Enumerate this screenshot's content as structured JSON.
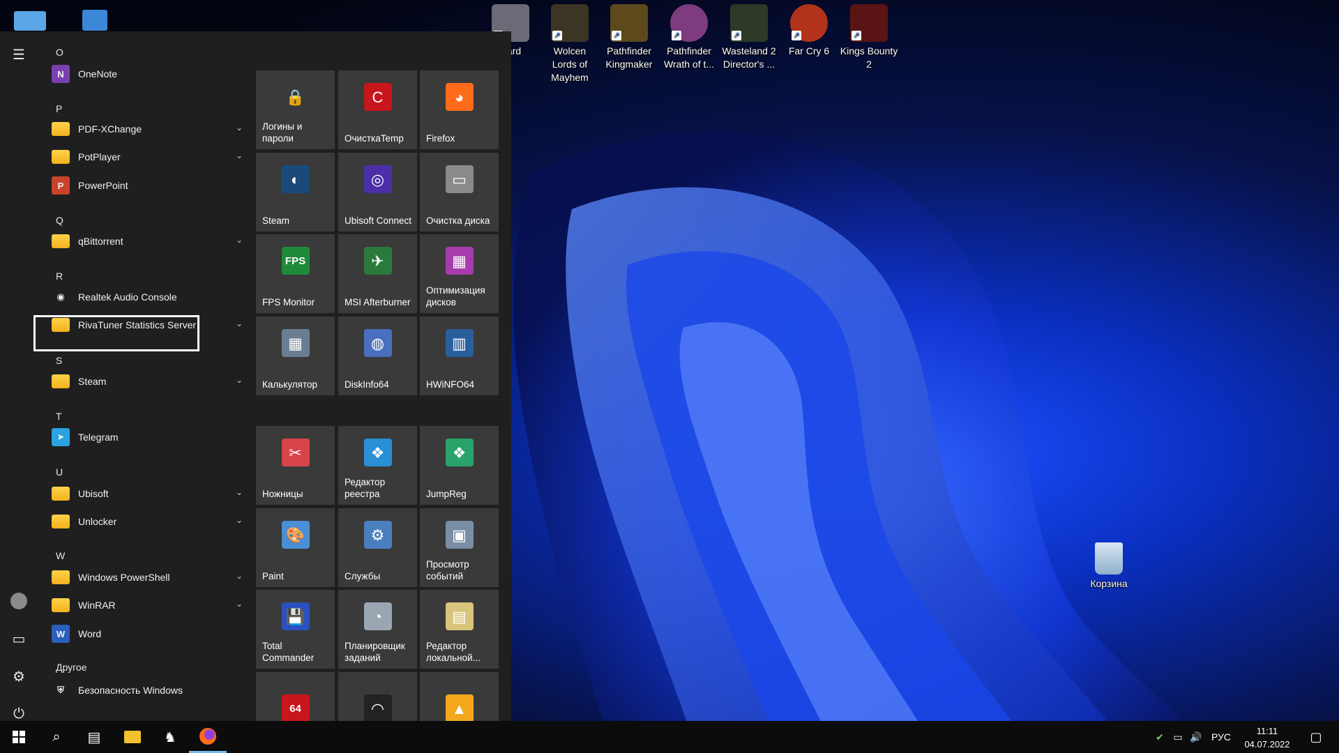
{
  "desktop": {
    "icons": [
      {
        "label": "ward",
        "color": "#6b6b78",
        "symbol": "✦"
      },
      {
        "label": "Wolcen Lords of Mayhem",
        "color": "#3d3524",
        "symbol": "W"
      },
      {
        "label": "Pathfinder Kingmaker",
        "color": "#5c4a1c",
        "symbol": "P"
      },
      {
        "label": "Pathfinder Wrath of t...",
        "color": "#7c3c7e",
        "symbol": "P"
      },
      {
        "label": "Wasteland 2 Director's ...",
        "color": "#2e3a28",
        "symbol": "▲"
      },
      {
        "label": "Far Cry 6",
        "color": "#b2321a",
        "symbol": "▲"
      },
      {
        "label": "Kings Bounty 2",
        "color": "#5a1414",
        "symbol": "♛"
      }
    ],
    "recycle_bin": {
      "label": "Корзина"
    }
  },
  "start_menu": {
    "rail": {
      "menu_icon": "hamburger-icon",
      "user_icon": "user-avatar-icon",
      "documents_icon": "documents-icon",
      "settings_icon": "gear-icon",
      "power_icon": "power-icon"
    },
    "apps": [
      {
        "type": "letter",
        "text": "O"
      },
      {
        "type": "app",
        "label": "OneNote",
        "icon": "onenote-icon",
        "color": "#7b3fb2",
        "glyph": "N",
        "expand": false
      },
      {
        "type": "letter",
        "text": "P"
      },
      {
        "type": "app",
        "label": "PDF-XChange",
        "icon": "folder-icon",
        "folder": true,
        "expand": true
      },
      {
        "type": "app",
        "label": "PotPlayer",
        "icon": "folder-icon",
        "folder": true,
        "expand": true
      },
      {
        "type": "app",
        "label": "PowerPoint",
        "icon": "powerpoint-icon",
        "color": "#c9432a",
        "glyph": "P",
        "expand": false
      },
      {
        "type": "letter",
        "text": "Q"
      },
      {
        "type": "app",
        "label": "qBittorrent",
        "icon": "folder-icon",
        "folder": true,
        "expand": true
      },
      {
        "type": "letter",
        "text": "R"
      },
      {
        "type": "app",
        "label": "Realtek Audio Console",
        "icon": "realtek-icon",
        "color": "#1f1f1f",
        "glyph": "◉",
        "expand": false
      },
      {
        "type": "app",
        "label": "RivaTuner Statistics Server",
        "icon": "folder-icon",
        "folder": true,
        "expand": true
      },
      {
        "type": "letter",
        "text": "S"
      },
      {
        "type": "app",
        "label": "Steam",
        "icon": "folder-icon",
        "folder": true,
        "expand": true
      },
      {
        "type": "letter",
        "text": "T"
      },
      {
        "type": "app",
        "label": "Telegram",
        "icon": "telegram-icon",
        "color": "#2aa3e0",
        "glyph": "➤",
        "expand": false
      },
      {
        "type": "letter",
        "text": "U"
      },
      {
        "type": "app",
        "label": "Ubisoft",
        "icon": "folder-icon",
        "folder": true,
        "expand": true
      },
      {
        "type": "app",
        "label": "Unlocker",
        "icon": "folder-icon",
        "folder": true,
        "expand": true
      },
      {
        "type": "letter",
        "text": "W"
      },
      {
        "type": "app",
        "label": "Windows PowerShell",
        "icon": "folder-icon",
        "folder": true,
        "expand": true
      },
      {
        "type": "app",
        "label": "WinRAR",
        "icon": "folder-icon",
        "folder": true,
        "expand": true
      },
      {
        "type": "app",
        "label": "Word",
        "icon": "word-icon",
        "color": "#2b5fbd",
        "glyph": "W",
        "expand": false
      },
      {
        "type": "letter",
        "text": "Другое"
      },
      {
        "type": "app",
        "label": "Безопасность Windows",
        "icon": "shield-icon",
        "color": "#1f1f1f",
        "glyph": "⛨",
        "expand": false
      }
    ],
    "tiles": [
      {
        "label": "Логины и пароли",
        "icon": "lock-icon",
        "glyph": "🔒",
        "color": "transparent"
      },
      {
        "label": "ОчисткаTemp",
        "icon": "ccleaner-icon",
        "glyph": "C",
        "color": "#c8161d"
      },
      {
        "label": "Firefox",
        "icon": "firefox-icon",
        "glyph": "◕",
        "color": "#ff6b1a"
      },
      {
        "label": "Steam",
        "icon": "steam-icon",
        "glyph": "◐",
        "color": "#1b4a7a"
      },
      {
        "label": "Ubisoft Connect",
        "icon": "ubisoft-icon",
        "glyph": "◎",
        "color": "#4a2fa8"
      },
      {
        "label": "Очистка диска",
        "icon": "disk-cleanup-icon",
        "glyph": "▭",
        "color": "#8a8a8a"
      },
      {
        "label": "FPS Monitor",
        "icon": "fps-monitor-icon",
        "glyph": "FPS",
        "color": "#1f8a3a"
      },
      {
        "label": "MSI Afterburner",
        "icon": "afterburner-icon",
        "glyph": "✈",
        "color": "#2b7a3c"
      },
      {
        "label": "Оптимизация дисков",
        "icon": "defrag-icon",
        "glyph": "▦",
        "color": "#a83cae"
      },
      {
        "label": "Калькулятор",
        "icon": "calculator-icon",
        "glyph": "▦",
        "color": "#6a7d93"
      },
      {
        "label": "DiskInfo64",
        "icon": "diskinfo-icon",
        "glyph": "◍",
        "color": "#4a6fbf"
      },
      {
        "label": "HWiNFO64",
        "icon": "hwinfo-icon",
        "glyph": "▥",
        "color": "#2a5f9e"
      },
      {
        "label": "Ножницы",
        "icon": "scissors-icon",
        "glyph": "✂",
        "color": "#d8444a"
      },
      {
        "label": "Редактор реестра",
        "icon": "registry-icon",
        "glyph": "❖",
        "color": "#2b8fd6"
      },
      {
        "label": "JumpReg",
        "icon": "jumpreg-icon",
        "glyph": "❖",
        "color": "#2aa36a"
      },
      {
        "label": "Paint",
        "icon": "paint-icon",
        "glyph": "🎨",
        "color": "#4a8fd6"
      },
      {
        "label": "Службы",
        "icon": "services-icon",
        "glyph": "⚙",
        "color": "#4a7fbf"
      },
      {
        "label": "Просмотр событий",
        "icon": "event-viewer-icon",
        "glyph": "▣",
        "color": "#7a8fa6"
      },
      {
        "label": "Total Commander",
        "icon": "total-commander-icon",
        "glyph": "💾",
        "color": "#2a4fbf"
      },
      {
        "label": "Планировщик заданий",
        "icon": "task-scheduler-icon",
        "glyph": "◔",
        "color": "#9aa6b2"
      },
      {
        "label": "Редактор локальной...",
        "icon": "policy-editor-icon",
        "glyph": "▤",
        "color": "#d8c47a"
      },
      {
        "label": "",
        "icon": "aida64-icon",
        "glyph": "64",
        "color": "#c8161d"
      },
      {
        "label": "",
        "icon": "speedometer-icon",
        "glyph": "◠",
        "color": "#222222"
      },
      {
        "label": "",
        "icon": "aimp-icon",
        "glyph": "▲",
        "color": "#f2a71c"
      }
    ]
  },
  "taskbar": {
    "start_icon": "windows-start-icon",
    "search_icon": "search-icon",
    "task_view_icon": "task-view-icon",
    "explorer_icon": "file-explorer-icon",
    "app_icon": "fox-app-icon",
    "firefox_icon": "firefox-icon",
    "tray": {
      "language": "РУС",
      "time": "11:11",
      "date": "04.07.2022"
    }
  }
}
